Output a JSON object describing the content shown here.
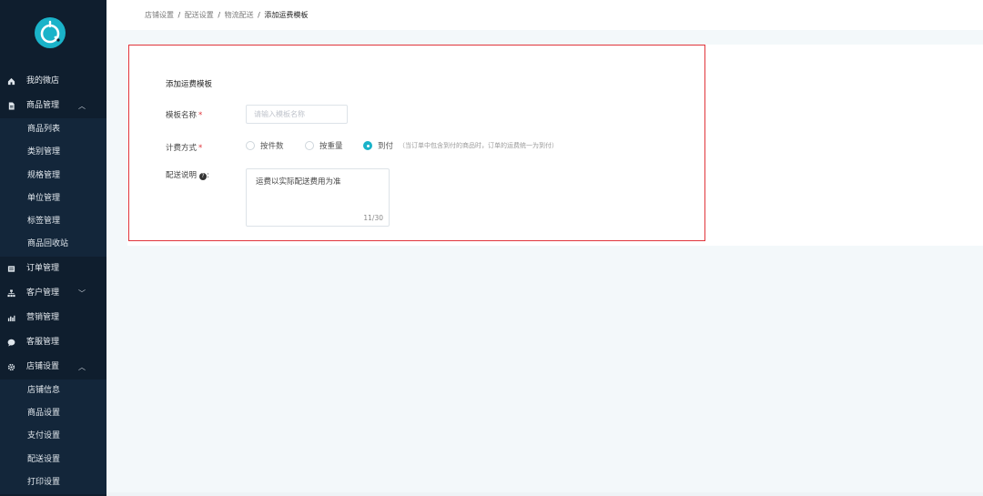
{
  "sidebar": {
    "items": [
      {
        "label": "我的微店",
        "icon": "home-icon"
      },
      {
        "label": "商品管理",
        "icon": "document-icon",
        "expanded": true,
        "children": [
          "商品列表",
          "类别管理",
          "规格管理",
          "单位管理",
          "标签管理",
          "商品回收站"
        ]
      },
      {
        "label": "订单管理",
        "icon": "list-icon"
      },
      {
        "label": "客户管理",
        "icon": "org-chart-icon",
        "expanded": false
      },
      {
        "label": "营销管理",
        "icon": "bar-chart-icon"
      },
      {
        "label": "客服管理",
        "icon": "chat-icon"
      },
      {
        "label": "店铺设置",
        "icon": "gear-icon",
        "expanded": true,
        "children": [
          "店铺信息",
          "商品设置",
          "支付设置",
          "配送设置",
          "打印设置"
        ]
      }
    ]
  },
  "breadcrumb": {
    "items": [
      "店铺设置",
      "配送设置",
      "物流配送"
    ],
    "current": "添加运费模板",
    "separator": "/"
  },
  "form": {
    "title": "添加运费模板",
    "name_label": "模板名称",
    "required_mark": "*",
    "name_placeholder": "请输入模板名称",
    "name_value": "",
    "billing_label": "计费方式",
    "billing_options": [
      "按件数",
      "按重量",
      "到付"
    ],
    "billing_selected": "到付",
    "billing_hint": "（当订单中包含到付的商品时，订单的运费统一为到付）",
    "desc_label": "配送说明",
    "desc_colon": ":",
    "help_glyph": "?",
    "desc_value": "运费以实际配送费用为准",
    "desc_count": "11/30"
  },
  "colors": {
    "sidebar_bg": "#0f1e2e",
    "accent": "#1ab3c9",
    "highlight_border": "#e0343a",
    "required": "#e0343a"
  }
}
